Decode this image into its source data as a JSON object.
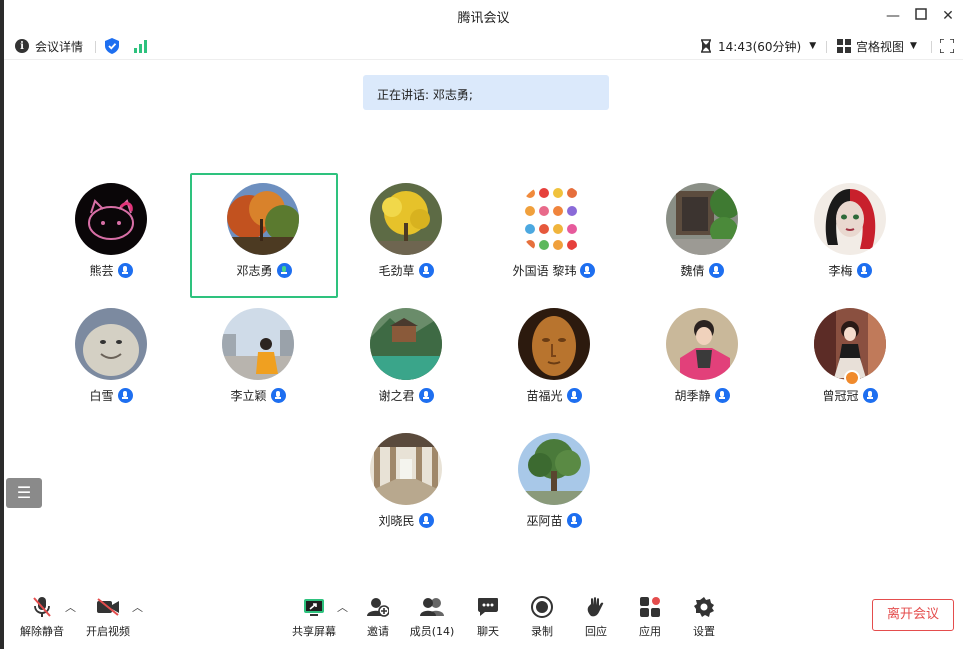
{
  "window": {
    "title": "腾讯会议"
  },
  "infobar": {
    "details_label": "会议详情",
    "timer": "14:43(60分钟)",
    "view_label": "宫格视图"
  },
  "speaking": {
    "text": "正在讲话: 邓志勇;"
  },
  "participants": [
    {
      "name": "熊芸"
    },
    {
      "name": "邓志勇"
    },
    {
      "name": "毛劲草"
    },
    {
      "name": "外国语 黎玮"
    },
    {
      "name": "魏倩"
    },
    {
      "name": "李梅"
    },
    {
      "name": "白雪"
    },
    {
      "name": "李立颖"
    },
    {
      "name": "谢之君"
    },
    {
      "name": "苗福光"
    },
    {
      "name": "胡季静"
    },
    {
      "name": "曾冠冠"
    },
    {
      "name": "刘晓民"
    },
    {
      "name": "巫阿苗"
    }
  ],
  "toolbar": {
    "unmute": "解除静音",
    "video": "开启视频",
    "share": "共享屏幕",
    "invite": "邀请",
    "members": "成员(14)",
    "chat": "聊天",
    "record": "录制",
    "react": "回应",
    "apps": "应用",
    "settings": "设置",
    "leave": "离开会议"
  },
  "colors": {
    "accent": "#1e6ff0",
    "active_border": "#2ec27e",
    "leave": "#e44d4d",
    "banner": "#dbe9fb"
  }
}
